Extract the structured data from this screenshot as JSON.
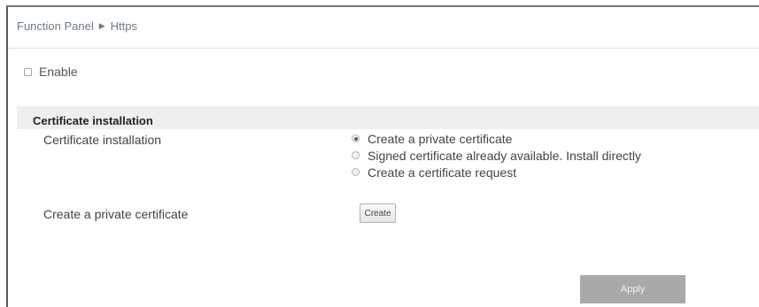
{
  "breadcrumb": {
    "root": "Function Panel",
    "separator_icon": "triangle-right-icon",
    "current": "Https"
  },
  "enable": {
    "label": "Enable",
    "checked": false
  },
  "section": {
    "title": "Certificate installation"
  },
  "fields": {
    "certificate_installation_label": "Certificate installation",
    "create_private_label": "Create a private certificate"
  },
  "radio_options": [
    {
      "label": "Create a private certificate",
      "checked": true
    },
    {
      "label": "Signed certificate already available. Install directly",
      "checked": false
    },
    {
      "label": "Create a certificate request",
      "checked": false
    }
  ],
  "buttons": {
    "create": "Create",
    "apply": "Apply"
  },
  "colors": {
    "apply_button": "#a9a9a9",
    "section_header_bg": "#efefef"
  }
}
